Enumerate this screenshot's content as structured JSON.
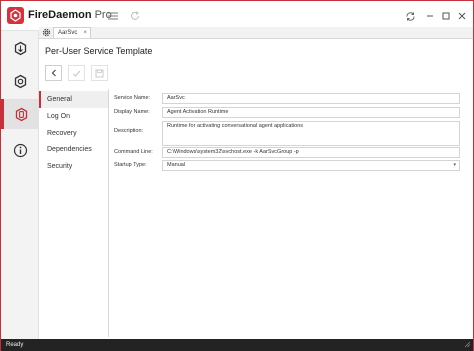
{
  "app": {
    "brand": "FireDaemon",
    "edition": "Pro"
  },
  "tab": {
    "label": "AarSvc",
    "close": "×"
  },
  "page": {
    "title": "Per-User Service Template"
  },
  "nav": {
    "items": [
      {
        "label": "General",
        "active": true
      },
      {
        "label": "Log On",
        "active": false
      },
      {
        "label": "Recovery",
        "active": false
      },
      {
        "label": "Dependencies",
        "active": false
      },
      {
        "label": "Security",
        "active": false
      }
    ]
  },
  "form": {
    "service_name": {
      "label": "Service Name:",
      "value": "AarSvc"
    },
    "display_name": {
      "label": "Display Name:",
      "value": "Agent Activation Runtime"
    },
    "description": {
      "label": "Description:",
      "value": "Runtime for activating conversational agent applications"
    },
    "command_line": {
      "label": "Command Line:",
      "value": "C:\\Windows\\system32\\svchost.exe -k AarSvcGroup -p"
    },
    "startup_type": {
      "label": "Startup Type:",
      "value": "Manual"
    }
  },
  "status": {
    "text": "Ready"
  },
  "colors": {
    "accent": "#c5303a",
    "statusbar": "#232323",
    "sidebar": "#f3f3f3"
  },
  "icons": {
    "sidebar": [
      "services-icon",
      "service-settings-icon",
      "per-user-template-icon",
      "info-icon"
    ],
    "titlebar": [
      "hamburger-menu-icon",
      "refresh-icon",
      "sync-icon"
    ]
  }
}
